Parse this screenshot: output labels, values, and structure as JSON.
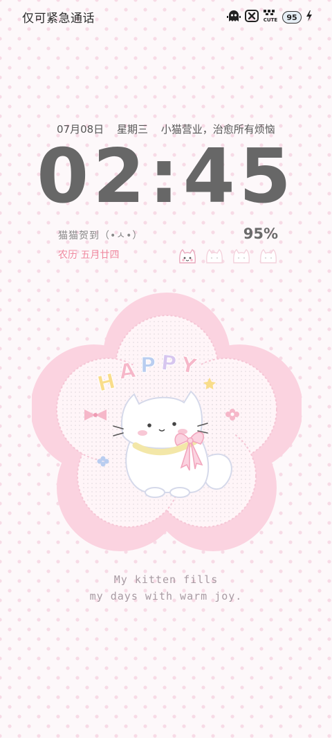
{
  "status_bar": {
    "carrier": "仅可紧急通话",
    "battery_level": "95",
    "badge_cute": "CUTE"
  },
  "lockscreen": {
    "date": "07月08日",
    "weekday": "星期三",
    "slogan": "小猫营业，治愈所有烦恼",
    "time": "02:45",
    "checkin": "猫猫贺到（•ㅅ•）",
    "battery_percent": "95%",
    "lunar_date": "农历 五月廿四",
    "sticker_text": "HAPPY",
    "caption_line1": "My kitten fills",
    "caption_line2": "my days with warm joy."
  },
  "colors": {
    "clock": "#676767",
    "lunar": "#f08aa0",
    "flower": "#fbd3e0",
    "background": "#fdf8fa"
  },
  "icons": [
    "ghost-icon",
    "close-box-icon",
    "cute-badge-icon",
    "battery-icon",
    "charging-bolt-icon",
    "cat-face-icon"
  ]
}
